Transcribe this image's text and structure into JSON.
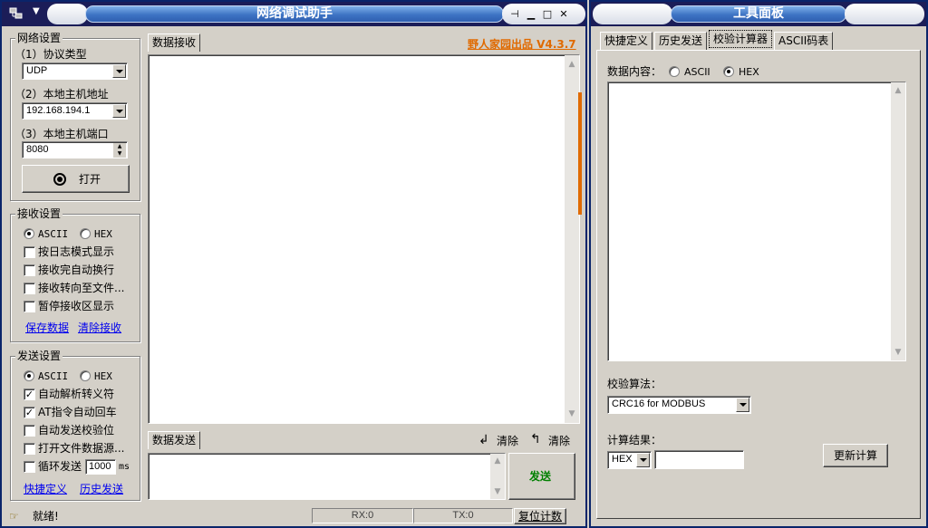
{
  "colors": {
    "titlebar": "#1b1d58",
    "brand_orange": "#e06a00",
    "send_green": "#008000",
    "link_blue": "#0000ee"
  },
  "main_window": {
    "title": "网络调试助手",
    "brand": "野人家园出品 V4.3.7"
  },
  "network_settings": {
    "group_label": "网络设置",
    "protocol_label": "（1）协议类型",
    "protocol_value": "UDP",
    "host_label": "（2）本地主机地址",
    "host_value": "192.168.194.1",
    "port_label": "（3）本地主机端口",
    "port_value": "8080",
    "open_button": "打开"
  },
  "receive_settings": {
    "group_label": "接收设置",
    "ascii_label": "ASCII",
    "hex_label": "HEX",
    "options": [
      {
        "label": "按日志模式显示",
        "checked": false
      },
      {
        "label": "接收完自动换行",
        "checked": false
      },
      {
        "label": "接收转向至文件...",
        "checked": false
      },
      {
        "label": "暂停接收区显示",
        "checked": false
      }
    ],
    "save_link": "保存数据",
    "clear_link": "清除接收"
  },
  "send_settings": {
    "group_label": "发送设置",
    "ascii_label": "ASCII",
    "hex_label": "HEX",
    "options": [
      {
        "label": "自动解析转义符",
        "checked": true
      },
      {
        "label": "AT指令自动回车",
        "checked": true
      },
      {
        "label": "自动发送校验位",
        "checked": false
      },
      {
        "label": "打开文件数据源...",
        "checked": false
      }
    ],
    "loop_label": "循环发送",
    "loop_value": "1000",
    "loop_unit": "ms",
    "shortcut_link": "快捷定义",
    "history_link": "历史发送"
  },
  "receive_area": {
    "tab": "数据接收"
  },
  "send_area": {
    "tab": "数据发送",
    "clear1": "清除",
    "clear2": "清除",
    "send_button": "发送"
  },
  "status_bar": {
    "status": "就绪!",
    "rx": "RX:0",
    "tx": "TX:0",
    "reset": "复位计数"
  },
  "tool_window": {
    "title": "工具面板",
    "tabs": [
      "快捷定义",
      "历史发送",
      "校验计算器",
      "ASCII码表"
    ],
    "data_label": "数据内容：",
    "ascii_label": "ASCII",
    "hex_label": "HEX",
    "algo_label": "校验算法：",
    "algo_value": "CRC16 for MODBUS",
    "result_label": "计算结果：",
    "result_format": "HEX",
    "result_value": "",
    "recalc_button": "更新计算"
  }
}
